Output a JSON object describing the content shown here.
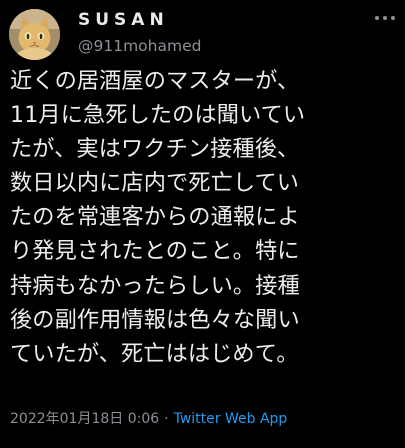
{
  "user": {
    "display_name": "SUSAN",
    "handle": "@911mohamed",
    "avatar_icon": "cat-photo-avatar"
  },
  "tweet": {
    "lines": [
      "近くの居酒屋のマスターが、",
      "11月に急死したのは聞いてい",
      "たが、実はワクチン接種後、",
      "数日以内に店内で死亡してい",
      "たのを常連客からの通報によ",
      "り発見されたとのこと。特に",
      "持病もなかったらしい。接種",
      "後の副作用情報は色々な聞い",
      "ていたが、死亡ははじめて。"
    ],
    "date": "2022年01月18日 0:06",
    "separator": "·",
    "source_app": "Twitter Web App"
  },
  "colors": {
    "background": "#000000",
    "text": "#e7e9ea",
    "secondary": "#8b9197",
    "accent": "#1d9bf0"
  },
  "menu": {
    "icon": "more-options-icon"
  }
}
